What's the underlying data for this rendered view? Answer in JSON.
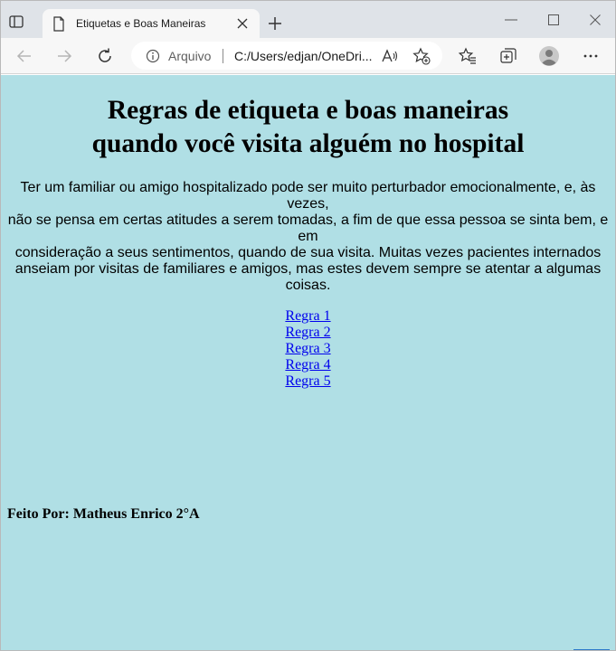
{
  "browser": {
    "tab_title": "Etiquetas e Boas Maneiras",
    "address_label": "Arquivo",
    "address_url": "C:/Users/edjan/OneDri...",
    "icons": [
      "tab-actions-icon",
      "document-icon",
      "close-icon",
      "plus-icon",
      "minimize-icon",
      "maximize-icon",
      "back-arrow-icon",
      "forward-arrow-icon",
      "refresh-icon",
      "info-icon",
      "read-aloud-icon",
      "add-favorite-icon",
      "favorites-icon",
      "collections-icon",
      "profile-icon",
      "more-icon"
    ]
  },
  "page": {
    "title_line1": "Regras de etiqueta e boas maneiras",
    "title_line2": "quando você visita alguém no hospital",
    "intro_lines": [
      "Ter um familiar ou amigo hospitalizado pode ser muito perturbador emocionalmente, e, às vezes,",
      "não se pensa em certas atitudes a serem tomadas, a fim de que essa pessoa se sinta bem, e em",
      "consideração a seus sentimentos, quando de sua visita. Muitas vezes pacientes internados",
      "anseiam por visitas de familiares e amigos, mas estes devem sempre se atentar a algumas coisas."
    ],
    "rules": [
      "Regra 1",
      "Regra 2",
      "Regra 3",
      "Regra 4",
      "Regra 5"
    ],
    "footer": "Feito Por: Matheus Enrico 2°A",
    "background_color": "#b0dfe5",
    "link_color": "#0000ee"
  }
}
